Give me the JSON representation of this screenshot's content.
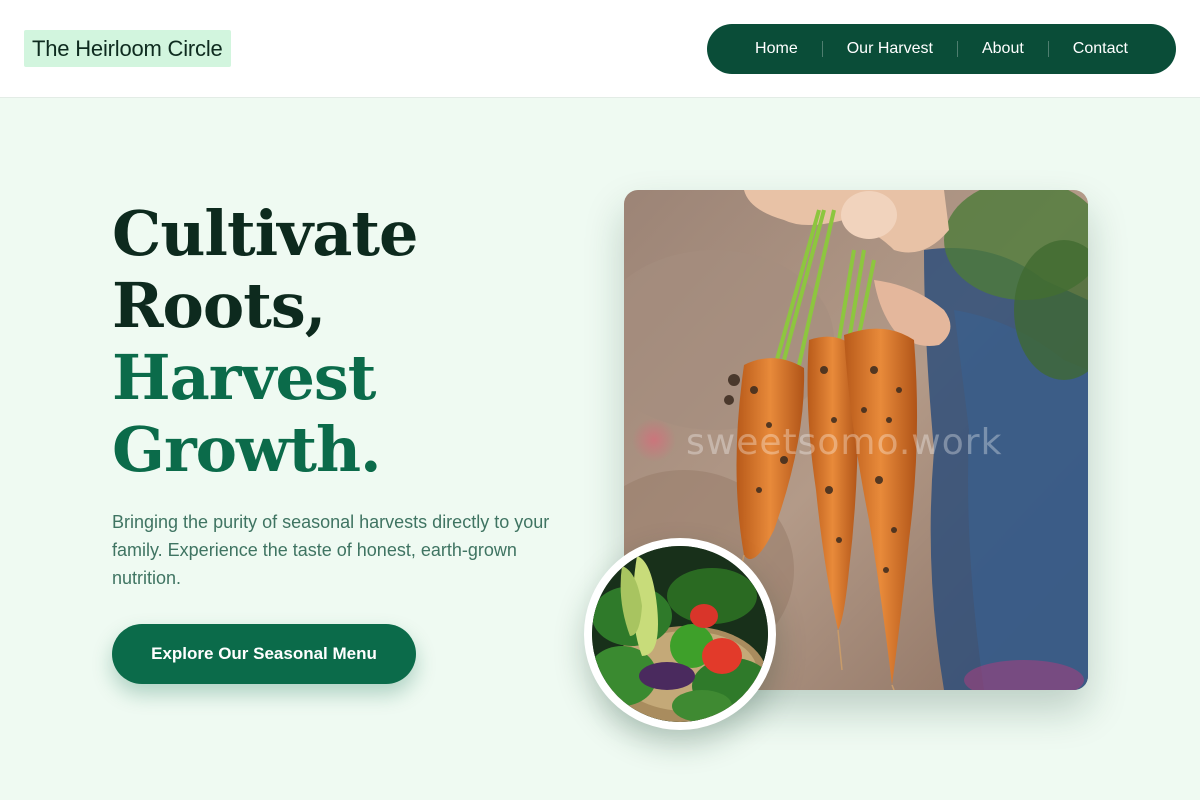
{
  "brand": {
    "name": "The Heirloom Circle"
  },
  "nav": {
    "items": [
      {
        "label": "Home"
      },
      {
        "label": "Our Harvest"
      },
      {
        "label": "About"
      },
      {
        "label": "Contact"
      }
    ]
  },
  "hero": {
    "title_line1": "Cultivate",
    "title_line2": "Roots,",
    "title_line3": "Harvest",
    "title_line4": "Growth.",
    "subtitle": "Bringing the purity of seasonal harvests directly to your family. Experience the taste of honest, earth-grown nutrition.",
    "cta_label": "Explore Our Seasonal Menu"
  },
  "images": {
    "main_photo": "hand-holding-fresh-carrots-photo",
    "main_watermark": "sweetsomo.work",
    "circle_photo": "basket-of-fresh-vegetables-photo"
  },
  "colors": {
    "nav_bg": "#0a4d38",
    "accent_green": "#0b6b4a",
    "heading_dark": "#0d2a1e",
    "brand_highlight": "#d2f5de",
    "page_bg": "#effaf2"
  }
}
